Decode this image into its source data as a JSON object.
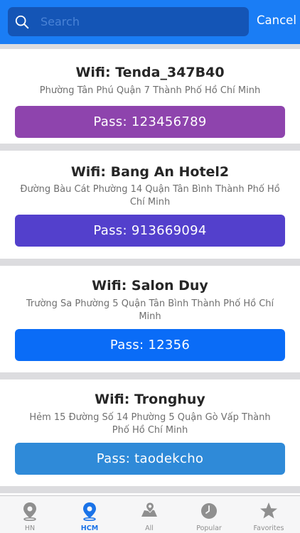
{
  "search": {
    "placeholder": "Search",
    "value": "",
    "cancel_label": "Cancel"
  },
  "wifi_list": [
    {
      "title": "Wifi: Tenda_347B40",
      "address": "Phường Tân Phú Quận 7 Thành Phố Hồ Chí Minh",
      "pass_label": "Pass: 123456789",
      "button_color": "#8e44ad"
    },
    {
      "title": "Wifi: Bang An Hotel2",
      "address": "Đường Bàu Cát Phường 14 Quận Tân Bình Thành Phố Hồ Chí Minh",
      "pass_label": "Pass: 913669094",
      "button_color": "#5340cc"
    },
    {
      "title": "Wifi: Salon Duy",
      "address": "Trường Sa Phường 5 Quận Tân Bình Thành Phố Hồ Chí Minh",
      "pass_label": "Pass: 12356",
      "button_color": "#0a6cf7"
    },
    {
      "title": "Wifi: Tronghuy",
      "address": "Hẻm 15 Đường Số 14 Phường 5 Quận Gò Vấp Thành Phố Hồ Chí Minh",
      "pass_label": "Pass: taodekcho",
      "button_color": "#2f8ad8"
    }
  ],
  "tabs": [
    {
      "label": "HN",
      "icon": "map-pin-icon",
      "active": false
    },
    {
      "label": "HCM",
      "icon": "map-pin-icon",
      "active": true
    },
    {
      "label": "All",
      "icon": "map-icon",
      "active": false
    },
    {
      "label": "Popular",
      "icon": "clock-icon",
      "active": false
    },
    {
      "label": "Favorites",
      "icon": "star-icon",
      "active": false
    }
  ],
  "colors": {
    "header": "#1a7df5",
    "search_field": "#1455b6",
    "tab_active": "#1a73e8",
    "tab_inactive": "#8f8f8f"
  }
}
